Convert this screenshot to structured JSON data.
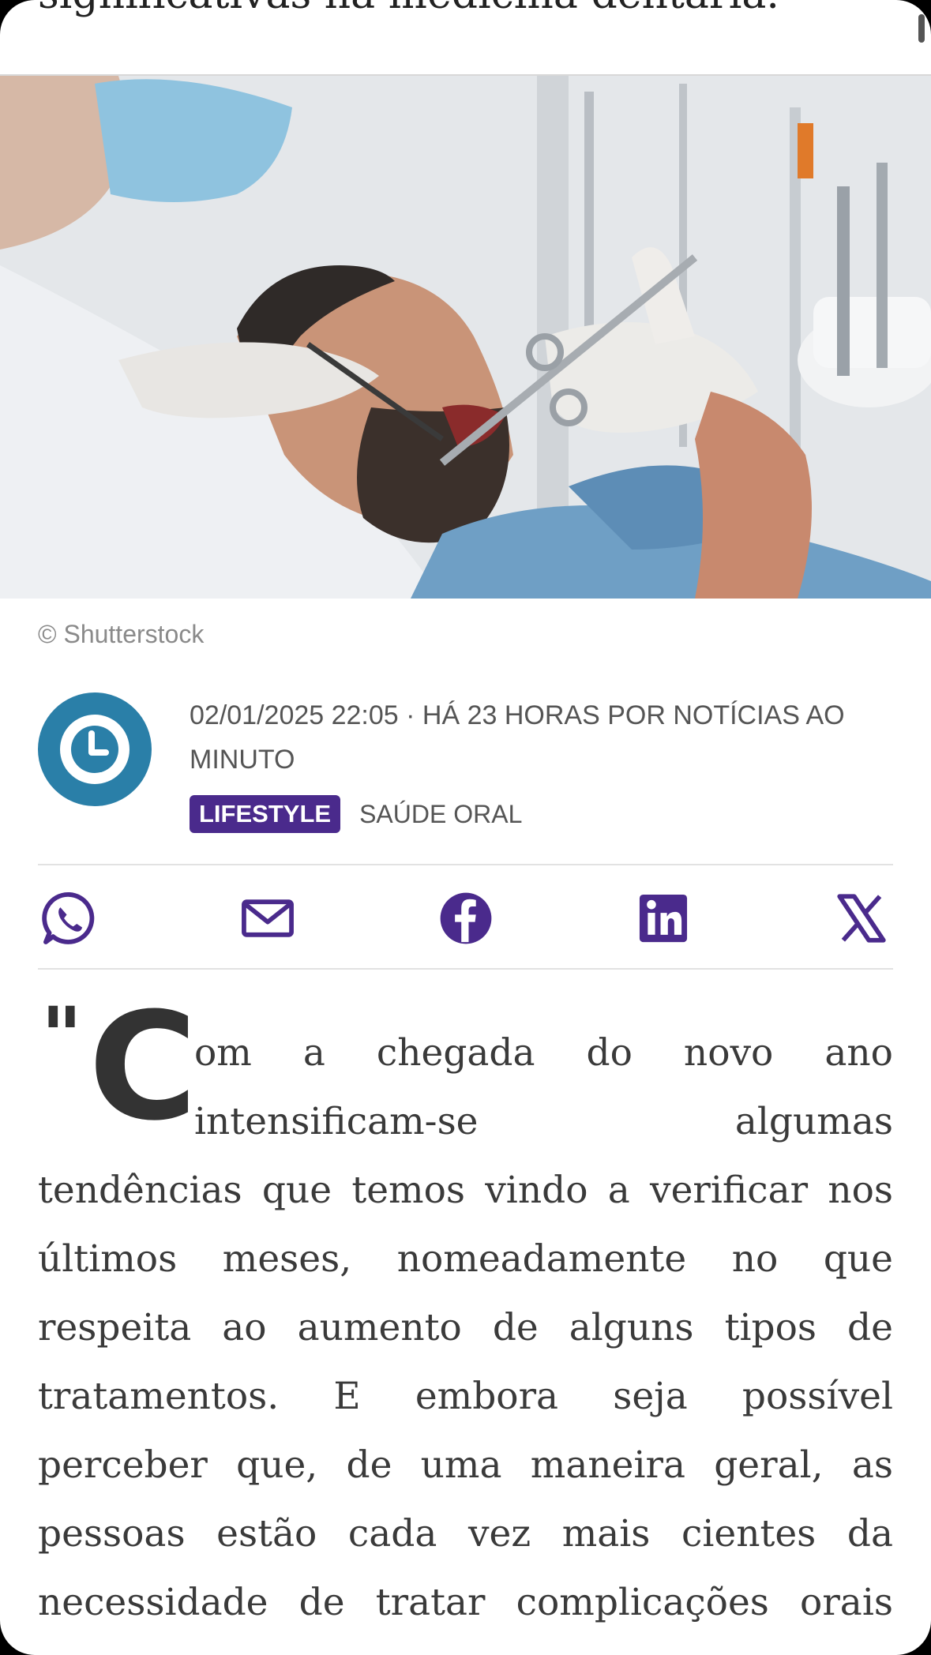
{
  "header": {
    "title_fragment": "significativas na medicina dentária."
  },
  "hero": {
    "alt": "dentist treating patient",
    "credit": "© Shutterstock"
  },
  "byline": {
    "meta": "02/01/2025 22:05 · HÁ 23 HORAS POR NOTÍCIAS AO MINUTO",
    "tag_primary": "LIFESTYLE",
    "tag_secondary": "SAÚDE ORAL",
    "avatar_icon": "clock-icon",
    "accent_color": "#2a7fa8",
    "tag_color": "#4a2a8c"
  },
  "share": {
    "icons": [
      "whatsapp-icon",
      "email-icon",
      "facebook-icon",
      "linkedin-icon",
      "x-icon"
    ],
    "icon_color": "#4a2a8c"
  },
  "article": {
    "quote_mark": "\"",
    "dropcap": "C",
    "lines": [
      "om a chegada do novo ano",
      "intensificam-se algumas",
      "tendências que temos vindo a verificar nos",
      "últimos meses, nomeadamente no que",
      "respeita ao aumento de alguns tipos de",
      "tratamentos. E embora seja possível",
      "perceber que, de uma maneira geral, as",
      "pessoas estão cada vez mais cientes da",
      "necessidade de tratar complicações orais"
    ]
  }
}
